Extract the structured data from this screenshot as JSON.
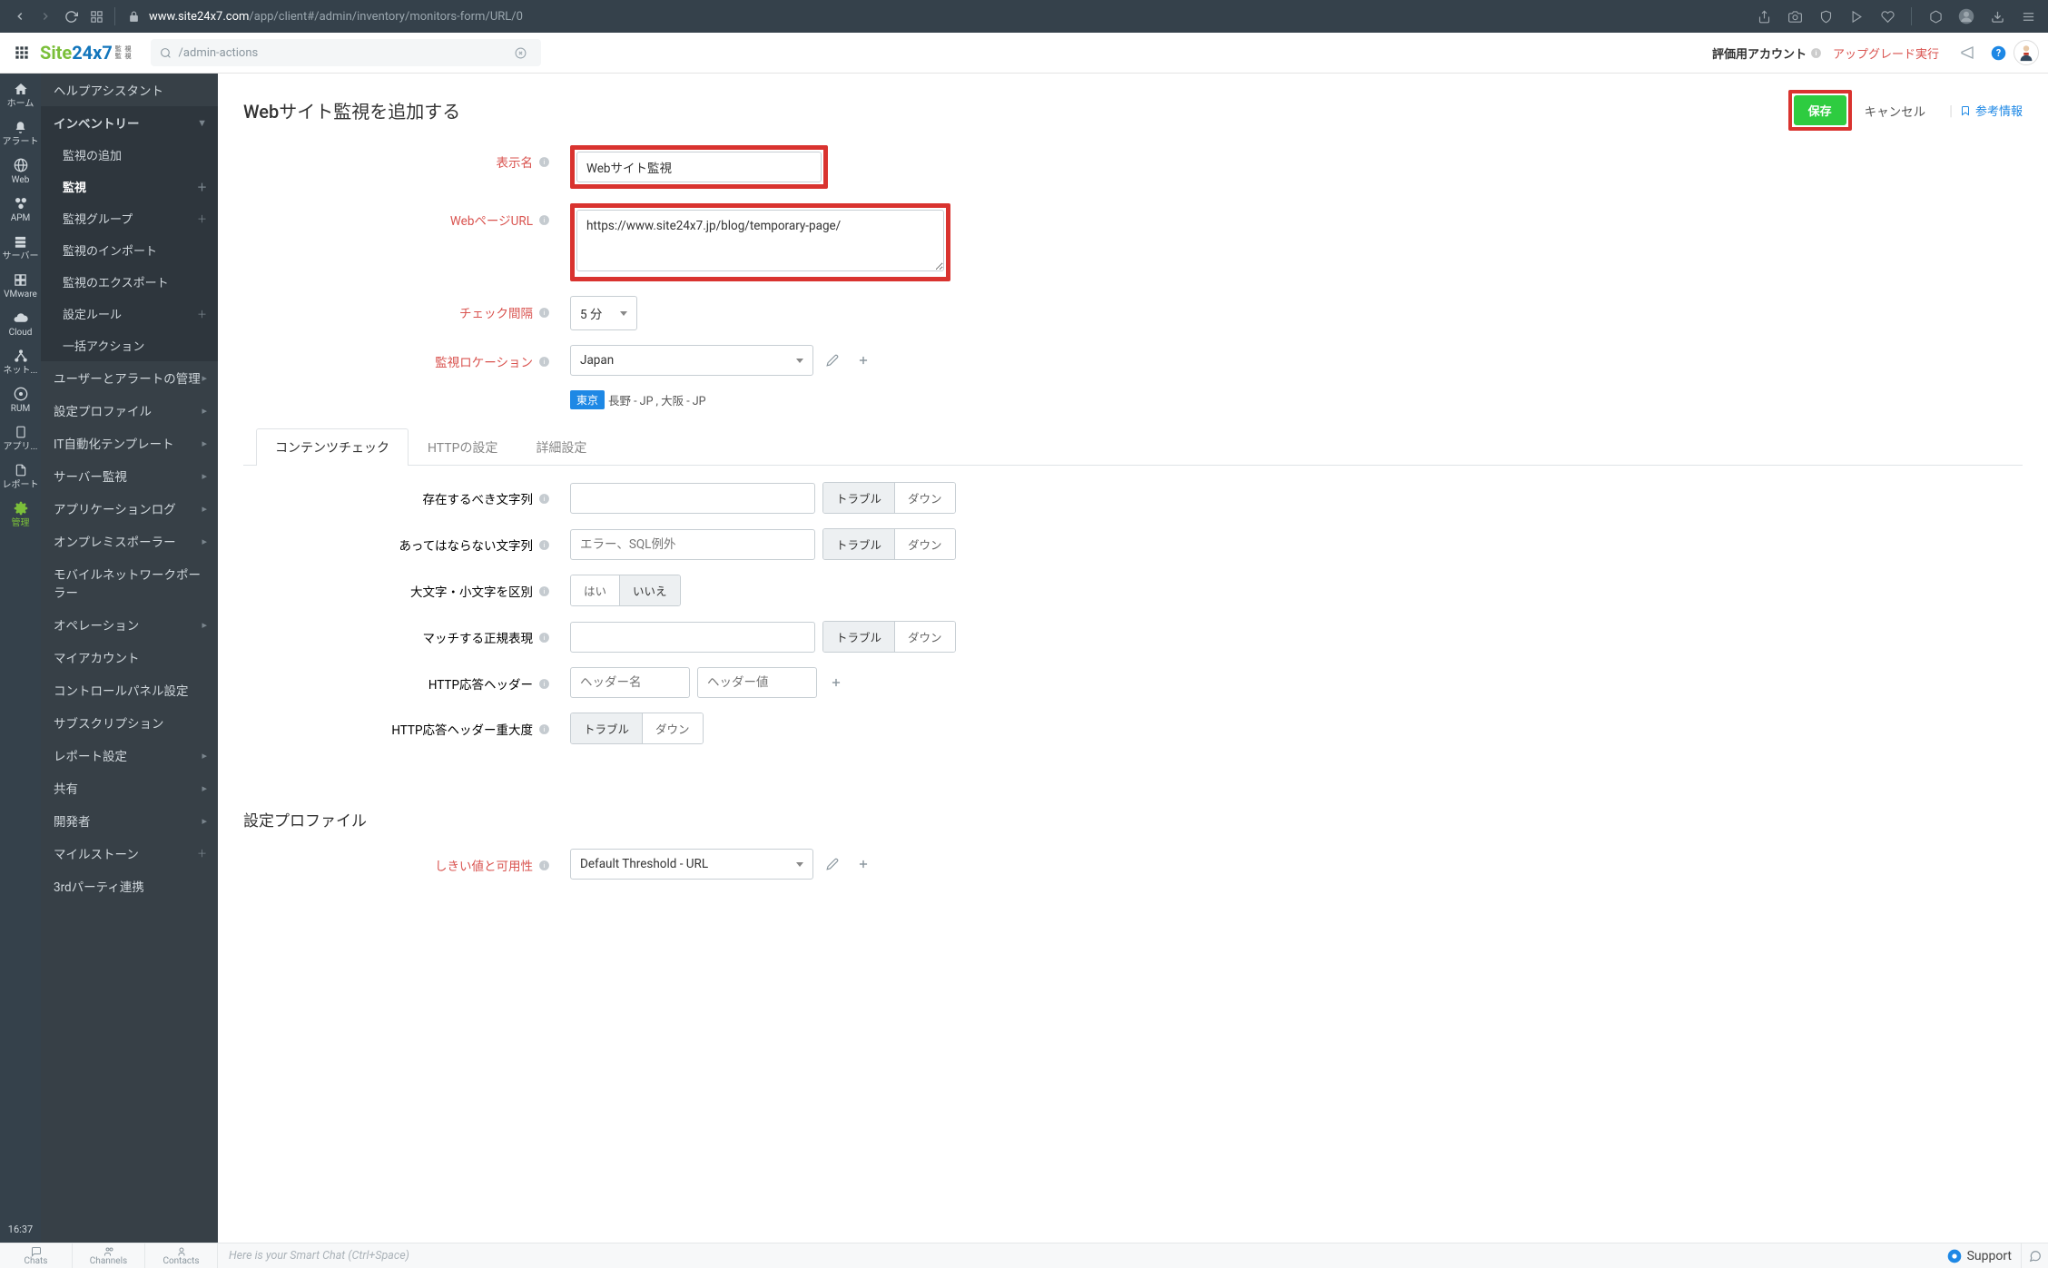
{
  "browser": {
    "url_host": "www.site24x7.com",
    "url_path": "/app/client#/admin/inventory/monitors-form/URL/0"
  },
  "header": {
    "search_placeholder": "/admin-actions",
    "account_label": "評価用アカウント",
    "upgrade_label": "アップグレード実行"
  },
  "rail": {
    "home": "ホーム",
    "alert": "アラート",
    "web": "Web",
    "apm": "APM",
    "server": "サーバー",
    "vmware": "VMware",
    "cloud": "Cloud",
    "network": "ネット...",
    "rum": "RUM",
    "app": "アプリ...",
    "report": "レポート",
    "admin": "管理",
    "clock": "16:37"
  },
  "sidebar": {
    "help_assistant": "ヘルプアシスタント",
    "inventory": "インベントリー",
    "sub": [
      "監視の追加",
      "監視",
      "監視グループ",
      "監視のインポート",
      "監視のエクスポート",
      "設定ルール",
      "一括アクション"
    ],
    "items": [
      "ユーザーとアラートの管理",
      "設定プロファイル",
      "IT自動化テンプレート",
      "サーバー監視",
      "アプリケーションログ",
      "オンプレミスポーラー",
      "モバイルネットワークポーラー",
      "オペレーション",
      "マイアカウント",
      "コントロールパネル設定",
      "サブスクリプション",
      "レポート設定",
      "共有",
      "開発者",
      "マイルストーン",
      "3rdパーティ連携"
    ]
  },
  "page": {
    "title": "Webサイト監視を追加する",
    "save": "保存",
    "cancel": "キャンセル",
    "reference": "参考情報"
  },
  "form": {
    "display_name_label": "表示名",
    "display_name_value": "Webサイト監視",
    "url_label": "WebページURL",
    "url_value": "https://www.site24x7.jp/blog/temporary-page/",
    "interval_label": "チェック間隔",
    "interval_value": "5 分",
    "location_label": "監視ロケーション",
    "location_value": "Japan",
    "loc_primary": "東京",
    "loc_secondary": "長野 - JP , 大阪 - JP"
  },
  "tabs": {
    "content": "コンテンツチェック",
    "http": "HTTPの設定",
    "advanced": "詳細設定"
  },
  "content_check": {
    "should_exist": "存在するべき文字列",
    "should_not_exist": "あってはならない文字列",
    "should_not_exist_placeholder": "エラー、SQL例外",
    "case_sensitive": "大文字・小文字を区別",
    "yes": "はい",
    "no": "いいえ",
    "regex": "マッチする正規表現",
    "resp_header": "HTTP応答ヘッダー",
    "header_name_placeholder": "ヘッダー名",
    "header_value_placeholder": "ヘッダー値",
    "resp_header_severity": "HTTP応答ヘッダー重大度",
    "trouble": "トラブル",
    "down": "ダウン"
  },
  "profile": {
    "section_title": "設定プロファイル",
    "threshold_label": "しきい値と可用性",
    "threshold_value": "Default Threshold - URL"
  },
  "footer": {
    "chats": "Chats",
    "channels": "Channels",
    "contacts": "Contacts",
    "hint": "Here is your Smart Chat (Ctrl+Space)",
    "support": "Support"
  }
}
